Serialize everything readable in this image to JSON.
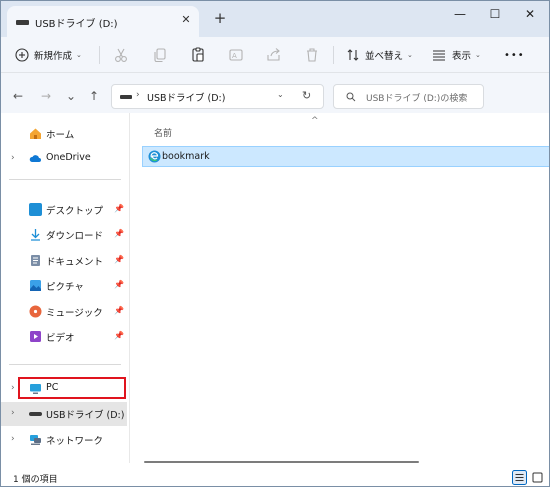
{
  "tab": {
    "title": "USBドライブ (D:)",
    "close_glyph": "✕",
    "newtab_glyph": "+"
  },
  "window_controls": {
    "minimize": "—",
    "maximize": "☐",
    "close": "✕"
  },
  "toolbar": {
    "new_label": "新規作成",
    "sort_label": "並べ替え",
    "view_label": "表示",
    "more_label": "•••",
    "caret": "⌄"
  },
  "nav": {
    "back": "←",
    "forward": "→",
    "recent": "⌄",
    "up": "↑",
    "address_sep": "›",
    "address_path": "USBドライブ (D:)",
    "address_caret": "⌄",
    "refresh": "↻",
    "search_placeholder": "USBドライブ (D:)の検索"
  },
  "sidebar": {
    "chevron": "›",
    "pin": "📌",
    "items": [
      {
        "label": "ホーム"
      },
      {
        "label": "OneDrive"
      },
      {
        "label": "デスクトップ"
      },
      {
        "label": "ダウンロード"
      },
      {
        "label": "ドキュメント"
      },
      {
        "label": "ピクチャ"
      },
      {
        "label": "ミュージック"
      },
      {
        "label": "ビデオ"
      },
      {
        "label": "PC"
      },
      {
        "label": "USBドライブ (D:)"
      },
      {
        "label": "ネットワーク"
      }
    ]
  },
  "content": {
    "column_name": "名前",
    "sort_arrow": "^",
    "files": [
      {
        "name": "bookmark"
      }
    ]
  },
  "status": {
    "item_count": "1 個の項目"
  },
  "colors": {
    "accent": "#0067c0",
    "highlight_box": "#e0141e",
    "selection_bg": "#cce8ff"
  }
}
